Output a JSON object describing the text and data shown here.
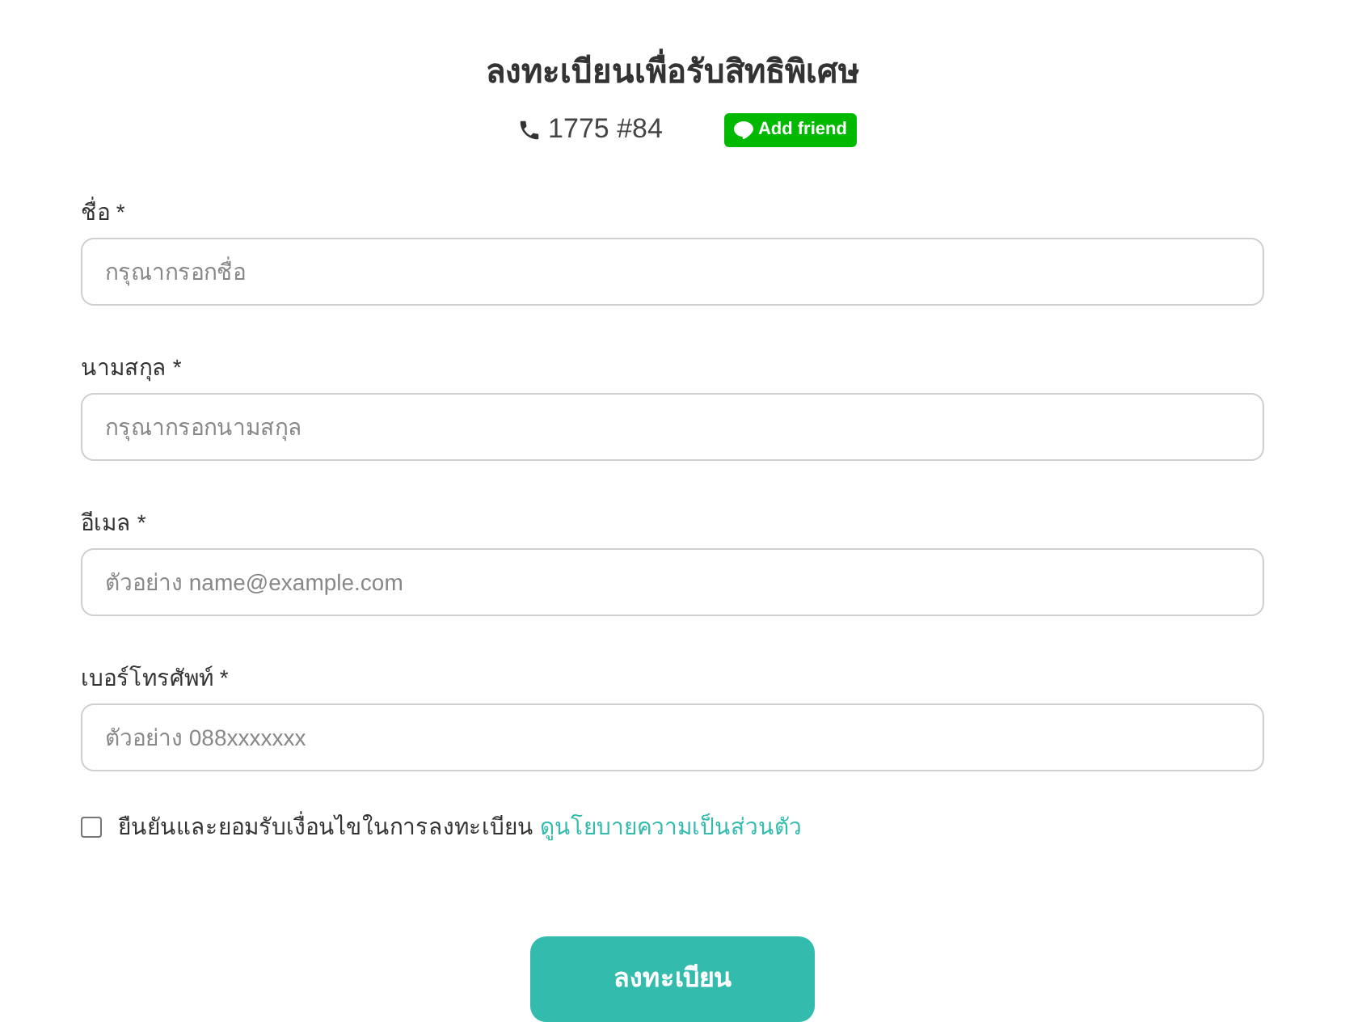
{
  "header": {
    "title": "ลงทะเบียนเพื่อรับสิทธิพิเศษ",
    "phone": "1775 #84",
    "line_button": "Add friend"
  },
  "fields": [
    {
      "label": "ชื่อ *",
      "placeholder": "กรุณากรอกชื่อ"
    },
    {
      "label": "นามสกุล *",
      "placeholder": "กรุณากรอกนามสกุล"
    },
    {
      "label": "อีเมล *",
      "placeholder": "ตัวอย่าง name@example.com"
    },
    {
      "label": "เบอร์โทรศัพท์ *",
      "placeholder": "ตัวอย่าง 088xxxxxxx"
    }
  ],
  "consent": {
    "checked": false,
    "text": "ยืนยันและยอมรับเงื่อนไขในการลงทะเบียน",
    "link": "ดูนโยบายความเป็นส่วนตัว"
  },
  "submit": "ลงทะเบียน"
}
